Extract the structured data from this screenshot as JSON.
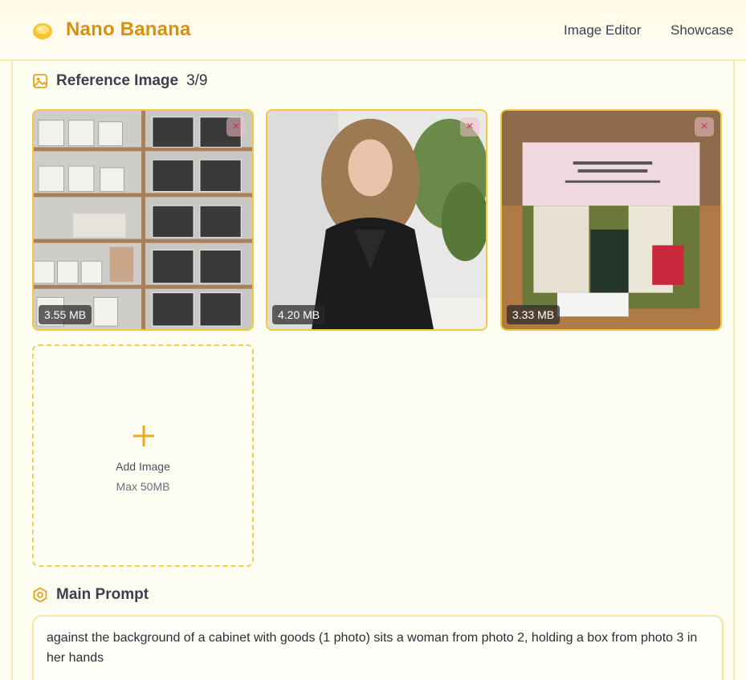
{
  "header": {
    "brand": "Nano Banana",
    "nav": {
      "editor": "Image Editor",
      "showcase": "Showcase"
    }
  },
  "reference": {
    "title": "Reference Image",
    "count": "3/9",
    "images": [
      {
        "size": "3.55 MB"
      },
      {
        "size": "4.20 MB"
      },
      {
        "size": "3.33 MB"
      }
    ],
    "remove_symbol": "×",
    "add": {
      "label": "Add Image",
      "limit": "Max 50MB"
    }
  },
  "prompt": {
    "title": "Main Prompt",
    "value": "against the background of a cabinet with goods (1 photo) sits a woman from photo 2, holding a box from photo 3 in her hands"
  },
  "colors": {
    "accent": "#d98f0f",
    "border": "#f0c93e",
    "remove": "#d43060"
  }
}
